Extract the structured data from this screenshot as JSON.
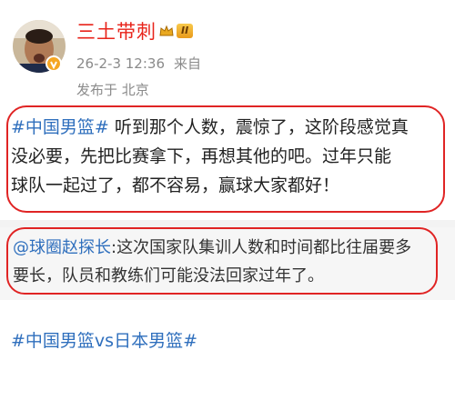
{
  "post": {
    "username": "三土带刺",
    "level_label": "II",
    "date": "26-2-3 12:36",
    "source": "来自",
    "location": "发布于 北京",
    "topic": "#中国男篮#",
    "body_line1": " 听到那个人数，震惊了，这阶段感觉真",
    "body_line2": "没必要，先把比赛拿下，再想其他的吧。过年只能",
    "body_line3": "球队一起过了，都不容易，赢球大家都好！"
  },
  "quote": {
    "mention": "@球圈赵探长",
    "text_line1": ":这次国家队集训人数和时间都比往届要多",
    "text_line2": "要长，队员和教练们可能没法回家过年了。"
  },
  "footer": {
    "topic_tag": "#中国男篮vs日本男篮#"
  },
  "colors": {
    "username": "#e8231a",
    "topic": "#2f6fbd",
    "highlight_border": "#e02424",
    "meta": "#8a8a8a"
  },
  "icons": {
    "avatar": "profile-photo",
    "verified": "verified-badge-icon",
    "crown": "crown-icon"
  }
}
